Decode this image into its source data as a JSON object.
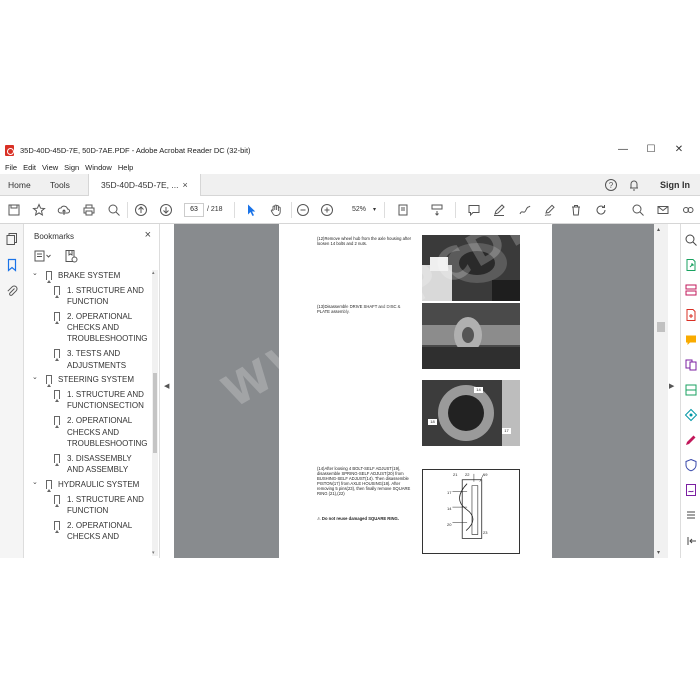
{
  "window": {
    "title": "35D-40D-45D-7E, 50D-7AE.PDF - Adobe Acrobat Reader DC (32-bit)",
    "minimize": "—",
    "maximize": "☐",
    "close": "✕"
  },
  "menu": [
    "File",
    "Edit",
    "View",
    "Sign",
    "Window",
    "Help"
  ],
  "tabs": {
    "home": "Home",
    "tools": "Tools",
    "document": "35D-40D-45D-7E, ...",
    "close": "×",
    "sign_in": "Sign In"
  },
  "toolbar": {
    "page_current": "63",
    "page_total": "/ 218",
    "zoom": "52%"
  },
  "bookmarks": {
    "title": "Bookmarks",
    "close": "×",
    "items": [
      {
        "level": 0,
        "label": "BRAKE SYSTEM",
        "expanded": true
      },
      {
        "level": 1,
        "label": "1. STRUCTURE AND FUNCTION"
      },
      {
        "level": 1,
        "label": "2. OPERATIONAL CHECKS AND TROUBLESHOOTING"
      },
      {
        "level": 1,
        "label": "3. TESTS AND ADJUSTMENTS"
      },
      {
        "level": 0,
        "label": "STEERING SYSTEM",
        "expanded": true
      },
      {
        "level": 1,
        "label": "1. STRUCTURE AND FUNCTIONSECTION"
      },
      {
        "level": 1,
        "label": "2. OPERATIONAL CHECKS AND TROUBLESHOOTING"
      },
      {
        "level": 1,
        "label": "3. DISASSEMBLY AND ASSEMBLY"
      },
      {
        "level": 0,
        "label": "HYDRAULIC SYSTEM",
        "expanded": true
      },
      {
        "level": 1,
        "label": "1. STRUCTURE AND FUNCTION"
      },
      {
        "level": 1,
        "label": "2. OPERATIONAL CHECKS AND"
      }
    ]
  },
  "document": {
    "steps": [
      {
        "text": "(12)Remove wheel hub from the axle housing after loosen 14 bolts and 2 nuts."
      },
      {
        "text": "(13)Disassemble DRIVE SHAFT and DISC & PLATE assembly."
      },
      {
        "text": "(14)After loosing 4 BOLT-SELF ADJUST(19), disassemble SPRING-SELF ADJUST(20) from BUSHING-SELF ADJUST(14). Then disassemble PISTON(17) from AXLE HOUSING(18). After removing 5 pins(23), then finally remove SQUARE RING (21),(22)"
      },
      {
        "text": "⚠ Do not reuse damaged SQUARE RING."
      }
    ],
    "callouts": [
      "14",
      "18",
      "17",
      "21",
      "22",
      "19",
      "20",
      "23"
    ],
    "watermark": "WWW.EPCDEPO.COM"
  },
  "colors": {
    "accent": "#1a73e8",
    "pdf_icon": "#d93025",
    "viewer_bg": "#888b8e"
  }
}
